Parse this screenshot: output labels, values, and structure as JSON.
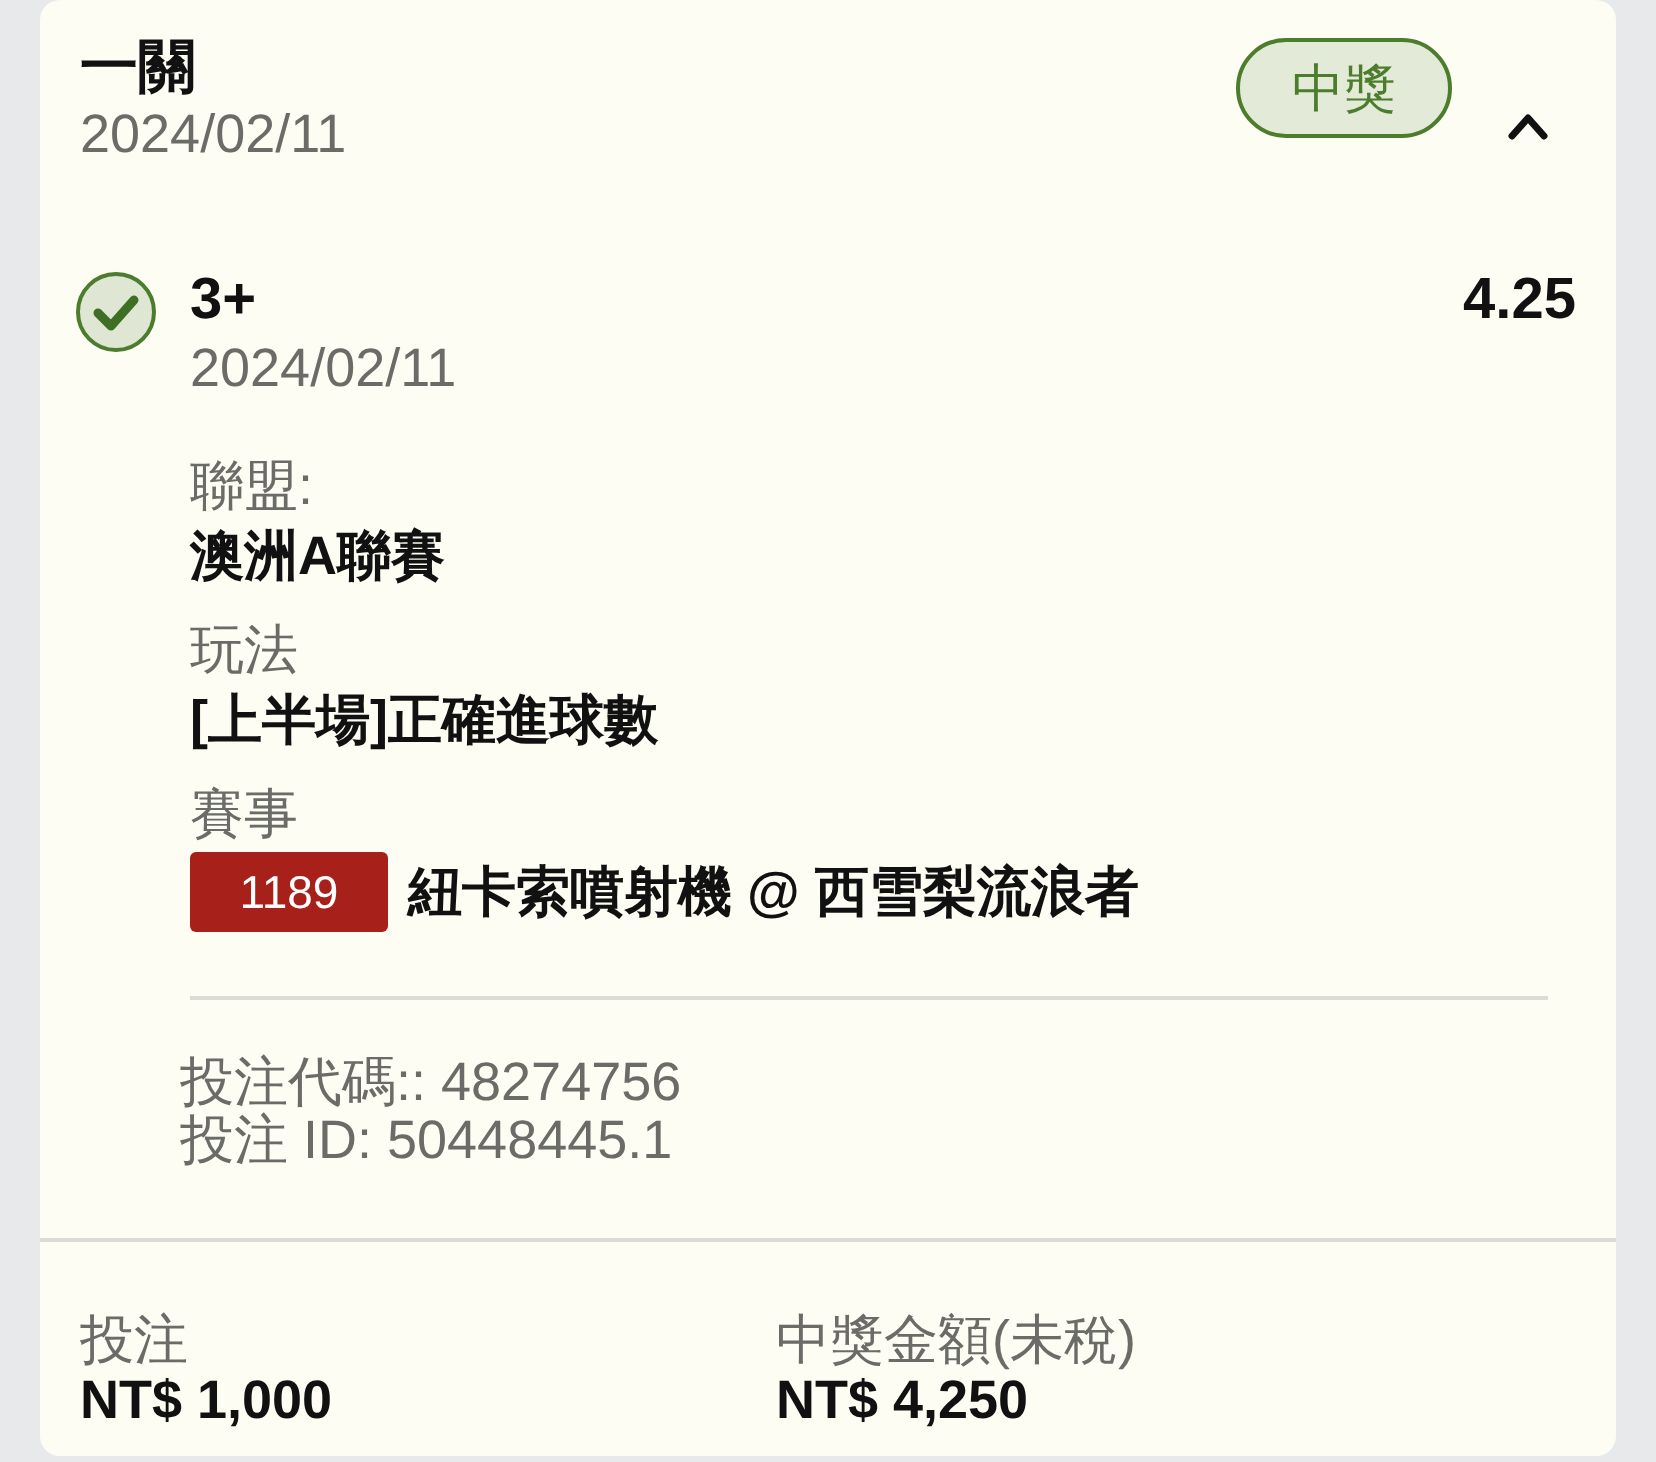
{
  "ticket": {
    "title": "一關",
    "date": "2024/02/11",
    "status": {
      "label": "中獎",
      "kind": "won"
    },
    "expanded": true
  },
  "selection": {
    "won": true,
    "pick": "3+",
    "odds": "4.25",
    "date": "2024/02/11",
    "fields": [
      {
        "kind": "text",
        "label": "聯盟:",
        "value": "澳洲A聯賽"
      },
      {
        "kind": "text",
        "label": "玩法",
        "value": "[上半場]正確進球數"
      },
      {
        "kind": "event",
        "label": "賽事",
        "code": "1189",
        "value": "紐卡索噴射機 @ 西雪梨流浪者"
      }
    ]
  },
  "references": [
    "投注代碼:: 48274756",
    "投注 ID: 50448445.1"
  ],
  "summary": [
    {
      "label": "投注",
      "value": "NT$ 1,000"
    },
    {
      "label": "中獎金額(未稅)",
      "value": "NT$ 4,250"
    }
  ]
}
